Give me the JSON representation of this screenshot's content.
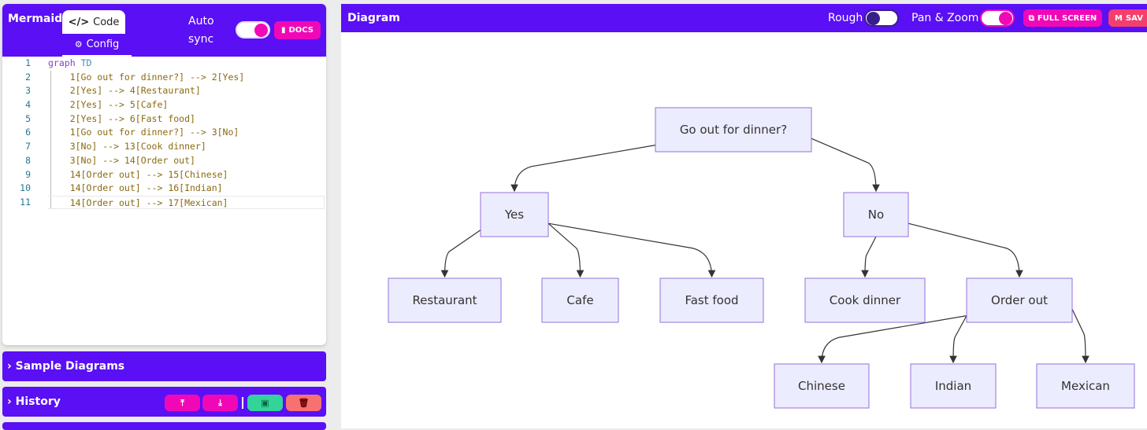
{
  "editor": {
    "brand": "Mermaid",
    "tab_code": "Code",
    "tab_config": "Config",
    "auto_sync": "Auto sync",
    "auto_sync_on": true,
    "docs": "DOCS",
    "lines": [
      "graph TD",
      "    1[Go out for dinner?] --> 2[Yes]",
      "    2[Yes] --> 4[Restaurant]",
      "    2[Yes] --> 5[Cafe]",
      "    2[Yes] --> 6[Fast food]",
      "    1[Go out for dinner?] --> 3[No]",
      "    3[No] --> 13[Cook dinner]",
      "    3[No] --> 14[Order out]",
      "    14[Order out] --> 15[Chinese]",
      "    14[Order out] --> 16[Indian]",
      "    14[Order out] --> 17[Mexican]"
    ]
  },
  "sample_diagrams": {
    "label": "Sample Diagrams"
  },
  "history": {
    "label": "History",
    "buttons": [
      "upload-icon",
      "download-icon",
      "save-icon",
      "trash-icon"
    ]
  },
  "diagram_panel": {
    "title": "Diagram",
    "rough": "Rough",
    "rough_on": false,
    "pan_zoom": "Pan & Zoom",
    "pan_zoom_on": true,
    "full_screen": "FULL SCREEN",
    "save": "SAV"
  },
  "colors": {
    "primary": "#5a0ff5",
    "pink": "#f008b7",
    "green": "#34d399",
    "red": "#f87171",
    "node_fill": "#ececff",
    "node_stroke": "#9370db"
  },
  "graph": {
    "nodes": [
      {
        "id": "1",
        "label": "Go out for dinner?"
      },
      {
        "id": "2",
        "label": "Yes"
      },
      {
        "id": "3",
        "label": "No"
      },
      {
        "id": "4",
        "label": "Restaurant"
      },
      {
        "id": "5",
        "label": "Cafe"
      },
      {
        "id": "6",
        "label": "Fast food"
      },
      {
        "id": "13",
        "label": "Cook dinner"
      },
      {
        "id": "14",
        "label": "Order out"
      },
      {
        "id": "15",
        "label": "Chinese"
      },
      {
        "id": "16",
        "label": "Indian"
      },
      {
        "id": "17",
        "label": "Mexican"
      }
    ],
    "edges": [
      [
        "1",
        "2"
      ],
      [
        "2",
        "4"
      ],
      [
        "2",
        "5"
      ],
      [
        "2",
        "6"
      ],
      [
        "1",
        "3"
      ],
      [
        "3",
        "13"
      ],
      [
        "3",
        "14"
      ],
      [
        "14",
        "15"
      ],
      [
        "14",
        "16"
      ],
      [
        "14",
        "17"
      ]
    ]
  }
}
